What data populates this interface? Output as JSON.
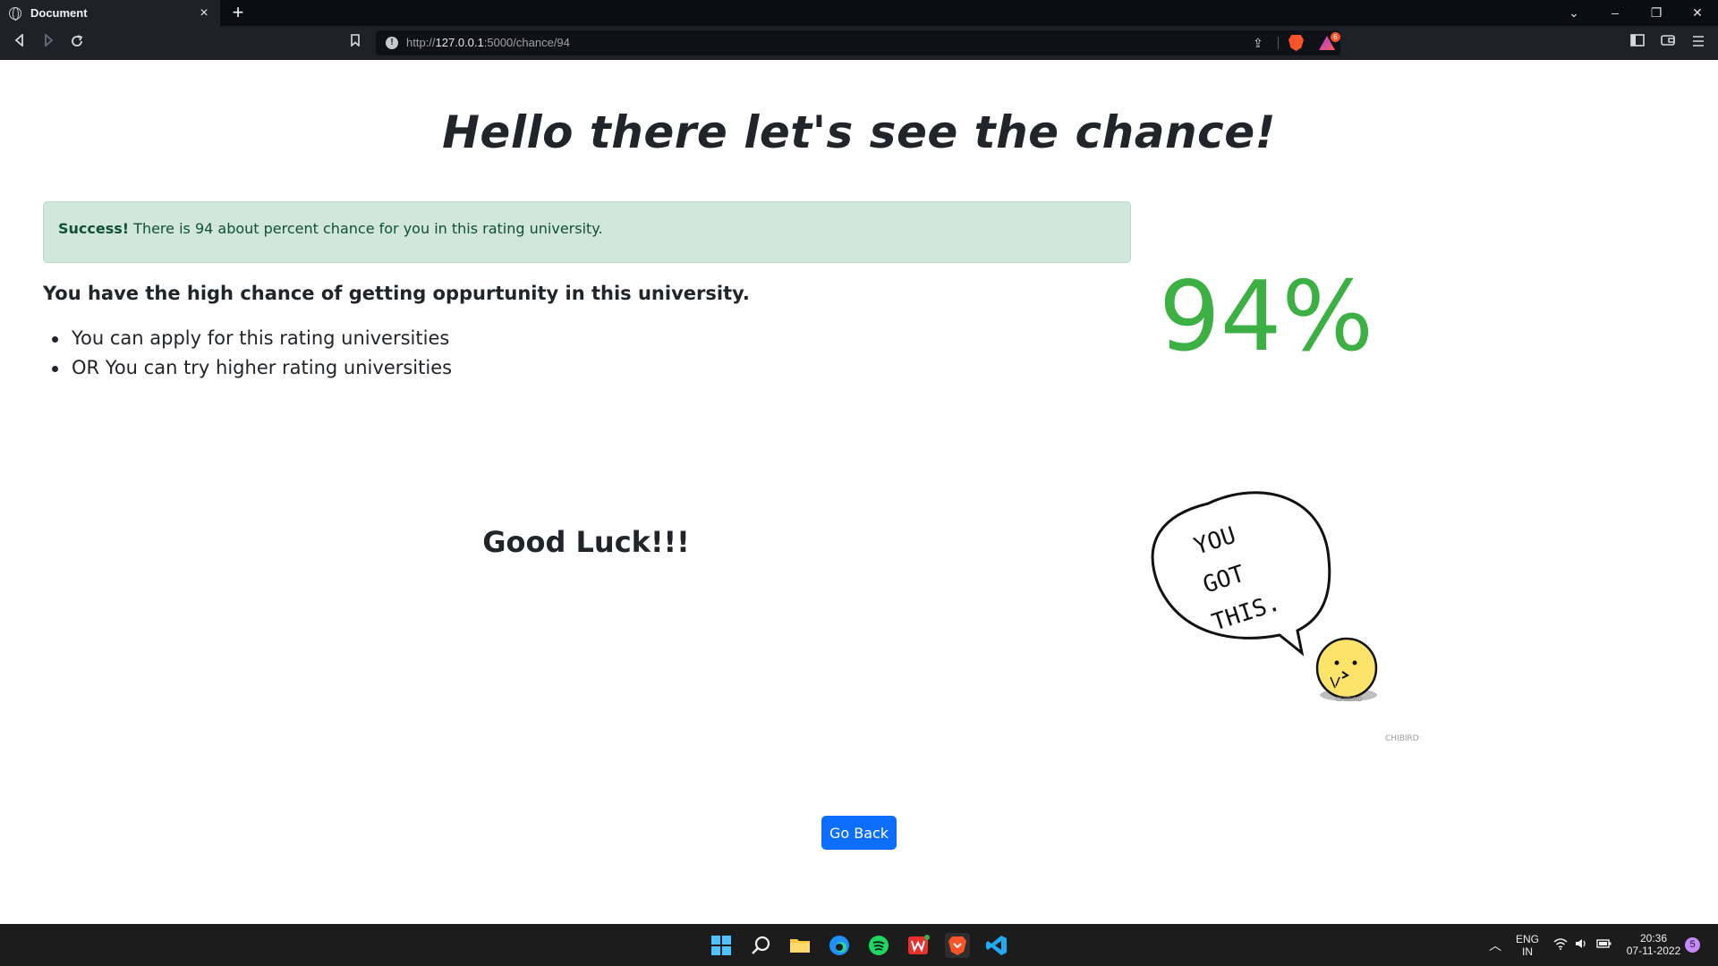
{
  "browser": {
    "tab_title": "Document",
    "tab_close": "×",
    "new_tab": "+",
    "url_prefix": "http://",
    "url_host": "127.0.0.1",
    "url_path": ":5000/chance/94",
    "rewards_count": "6"
  },
  "window_controls": {
    "chevron": "⌄",
    "minimize": "–",
    "restore": "❐",
    "close": "✕"
  },
  "page": {
    "heading": "Hello there let's see the chance!",
    "alert": {
      "strong": "Success!",
      "text": " There is 94 about percent chance for you in this rating university."
    },
    "lead": "You have the high chance of getting oppurtunity in this university.",
    "tips": [
      "You can apply for this rating universities",
      "OR You can try higher rating universities"
    ],
    "percent": "94%",
    "good_luck": "Good Luck!!!",
    "illustration": {
      "bubble_lines": [
        "YOU",
        "GOT",
        "THIS."
      ],
      "signature": "CHIBIRD",
      "bird_label": "CHIBIRD"
    },
    "go_back": "Go Back"
  },
  "colors": {
    "percent_green": "#3cb043",
    "alert_bg": "#d1e7dd",
    "alert_text": "#0f5132",
    "button_blue": "#0d6efd"
  },
  "taskbar": {
    "lang_top": "ENG",
    "lang_bottom": "IN",
    "time": "20:36",
    "date": "07-11-2022",
    "notifications": "5",
    "icons": [
      "windows-start",
      "search",
      "file-explorer",
      "edge",
      "spotify",
      "wps-office",
      "brave",
      "vscode"
    ]
  }
}
